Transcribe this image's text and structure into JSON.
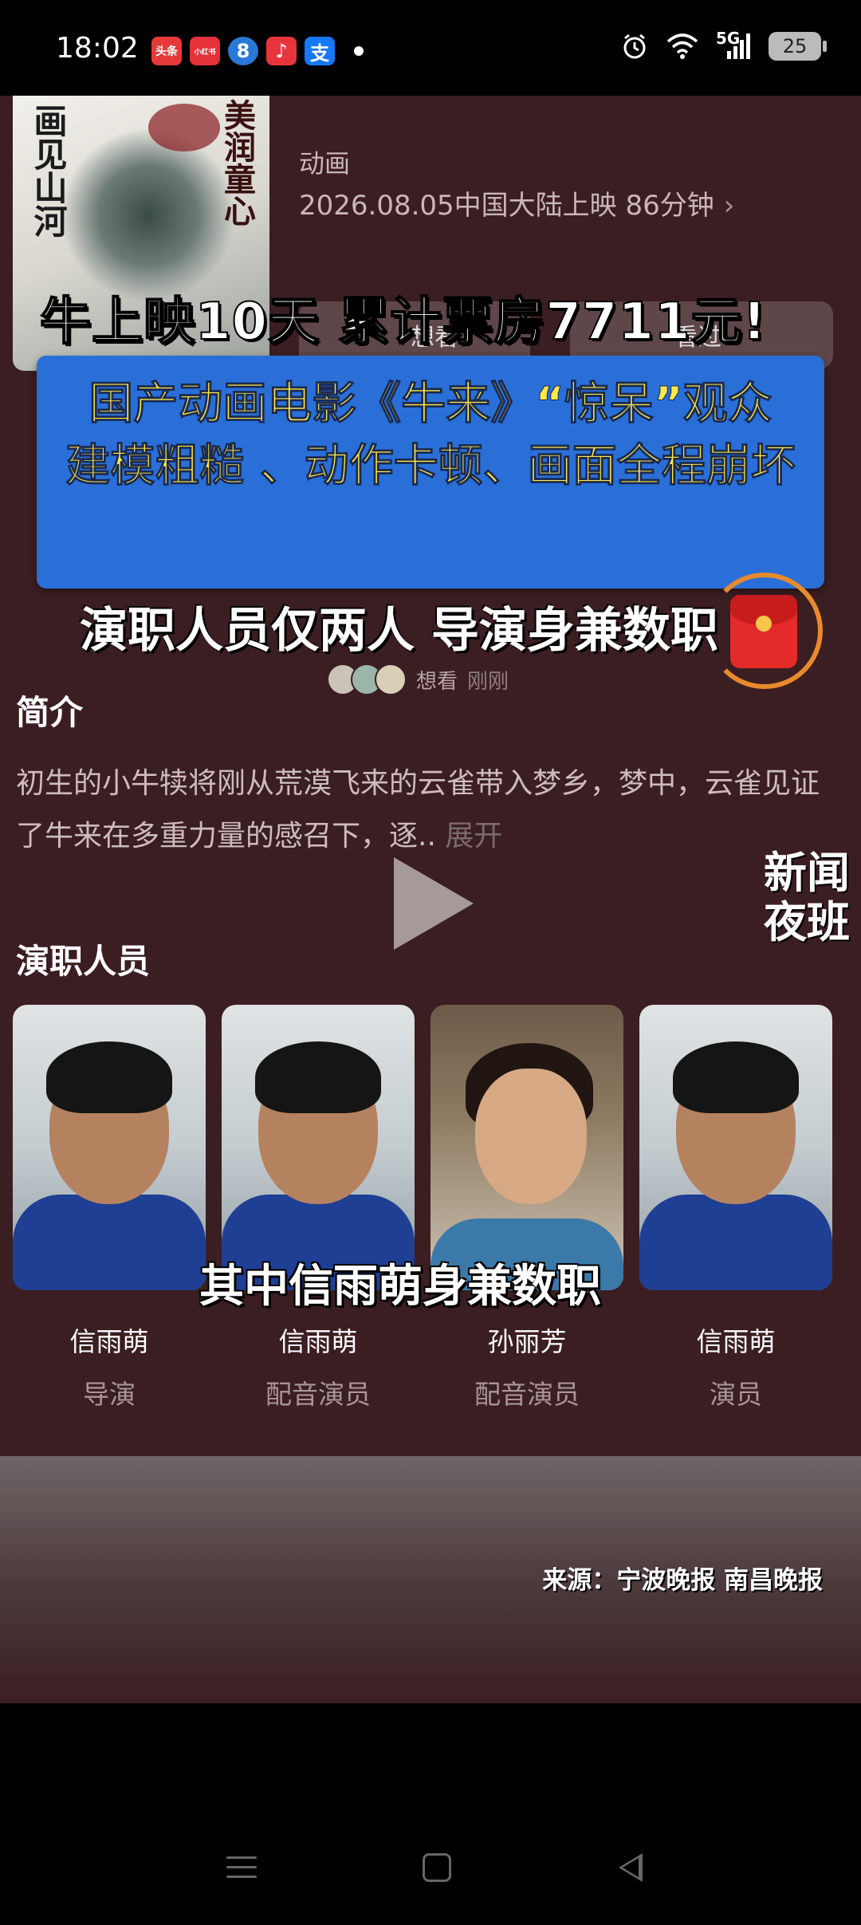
{
  "status_bar": {
    "time": "18:02",
    "notifications": [
      {
        "icon": "toutiao-app-icon",
        "label": "头条",
        "color": "#e63a3a"
      },
      {
        "icon": "xiaohongshu-app-icon",
        "label": "小红书",
        "color": "#e4313a"
      },
      {
        "icon": "news-app-icon",
        "label": "8",
        "color": "#2a78d6"
      },
      {
        "icon": "music-app-icon",
        "label": "♪",
        "color": "#e8353d"
      },
      {
        "icon": "alipay-app-icon",
        "label": "支",
        "color": "#1677ff"
      }
    ],
    "network": "5G",
    "battery": "25"
  },
  "movie": {
    "poster_text_left": "画见山河",
    "poster_text_right": "美润童心",
    "genre": "动画",
    "release": "2026.08.05中国大陆上映 86分钟",
    "want_button": "想看",
    "seen_button": "看过"
  },
  "overlay": {
    "headline1": "牛上映10天 累计票房7711元!",
    "banner_line1": "国产动画电影《牛来》“惊呆”观众",
    "banner_line2": "建模粗糙 、动作卡顿、画面全程崩坏",
    "headline3": "演职人员仅两人 导演身兼数职",
    "want_label": "想看",
    "want_time": "刚刚"
  },
  "intro": {
    "title": "简介",
    "text": "初生的小牛犊将刚从荒漠飞来的云雀带入梦乡，梦中，云雀见证了牛来在多重力量的感召下，逐..",
    "expand": "展开"
  },
  "watermark": {
    "line1": "新闻",
    "line2": "夜班"
  },
  "cast": {
    "title": "演职人员",
    "members": [
      {
        "name": "信雨萌",
        "role": "导演"
      },
      {
        "name": "信雨萌",
        "role": "配音演员"
      },
      {
        "name": "孙丽芳",
        "role": "配音演员"
      },
      {
        "name": "信雨萌",
        "role": "演员"
      }
    ]
  },
  "subtitle": "其中信雨萌身兼数职",
  "source": "来源：宁波晚报 南昌晚报"
}
